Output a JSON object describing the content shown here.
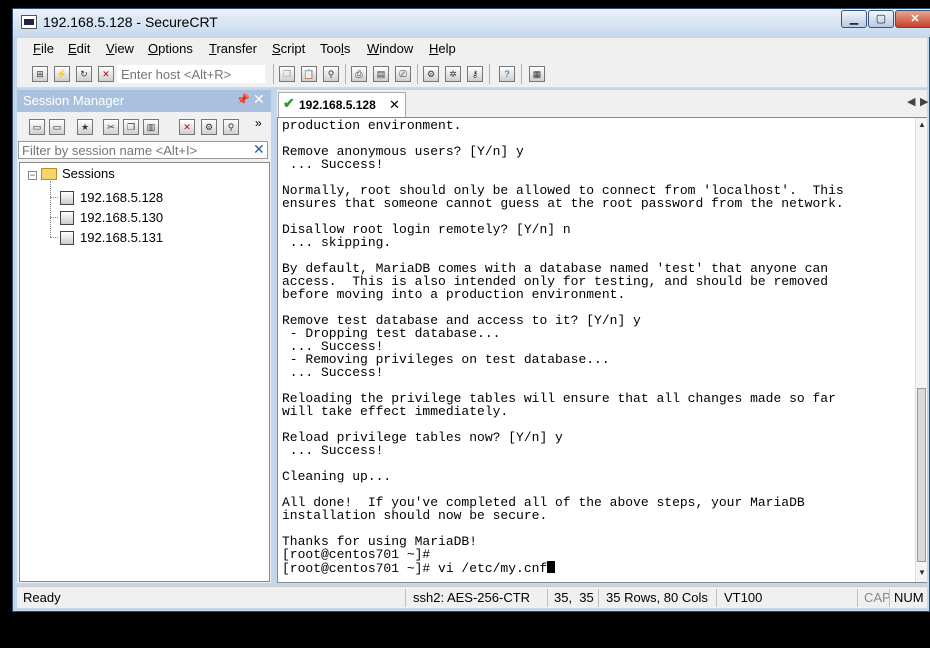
{
  "window": {
    "title": "192.168.5.128 - SecureCRT"
  },
  "menu": [
    {
      "mnemonic": "F",
      "rest": "ile"
    },
    {
      "mnemonic": "E",
      "rest": "dit"
    },
    {
      "mnemonic": "V",
      "rest": "iew"
    },
    {
      "mnemonic": "O",
      "rest": "ptions"
    },
    {
      "mnemonic": "T",
      "rest": "ransfer"
    },
    {
      "mnemonic": "S",
      "rest": "cript"
    },
    {
      "pre": "Too",
      "mnemonic": "l",
      "rest": "s"
    },
    {
      "mnemonic": "W",
      "rest": "indow"
    },
    {
      "mnemonic": "H",
      "rest": "elp"
    }
  ],
  "toolbar": {
    "host_placeholder": "Enter host <Alt+R>",
    "icons": [
      "connect-icon",
      "quick-connect-icon",
      "reconnect-icon",
      "disconnect-icon",
      "copy-icon",
      "paste-icon",
      "find-icon",
      "print-icon",
      "print-setup-icon",
      "session-options-icon",
      "global-options-icon",
      "keymap-icon",
      "help-icon",
      "sftp-icon"
    ]
  },
  "session_manager": {
    "title": "Session Manager",
    "filter_placeholder": "Filter by session name <Alt+I>",
    "folder": "Sessions",
    "sessions": [
      "192.168.5.128",
      "192.168.5.130",
      "192.168.5.131"
    ]
  },
  "tab": {
    "label": "192.168.5.128"
  },
  "terminal": {
    "lines": [
      "production environment.",
      "",
      "Remove anonymous users? [Y/n] y",
      " ... Success!",
      "",
      "Normally, root should only be allowed to connect from 'localhost'.  This",
      "ensures that someone cannot guess at the root password from the network.",
      "",
      "Disallow root login remotely? [Y/n] n",
      " ... skipping.",
      "",
      "By default, MariaDB comes with a database named 'test' that anyone can",
      "access.  This is also intended only for testing, and should be removed",
      "before moving into a production environment.",
      "",
      "Remove test database and access to it? [Y/n] y",
      " - Dropping test database...",
      " ... Success!",
      " - Removing privileges on test database...",
      " ... Success!",
      "",
      "Reloading the privilege tables will ensure that all changes made so far",
      "will take effect immediately.",
      "",
      "Reload privilege tables now? [Y/n] y",
      " ... Success!",
      "",
      "Cleaning up...",
      "",
      "All done!  If you've completed all of the above steps, your MariaDB",
      "installation should now be secure.",
      "",
      "Thanks for using MariaDB!",
      "[root@centos701 ~]#",
      "[root@centos701 ~]# vi /etc/my.cnf"
    ]
  },
  "status": {
    "ready": "Ready",
    "cipher": "ssh2: AES-256-CTR",
    "cursor_pos": "35,  35",
    "dimensions": "35 Rows, 80 Cols",
    "emulation": "VT100",
    "cap": "CAP",
    "num": "NUM"
  },
  "colors": {
    "title_gradient_top": "#eaf1fa",
    "panel_header": "#a9c0de",
    "close_button": "#c7402a"
  }
}
